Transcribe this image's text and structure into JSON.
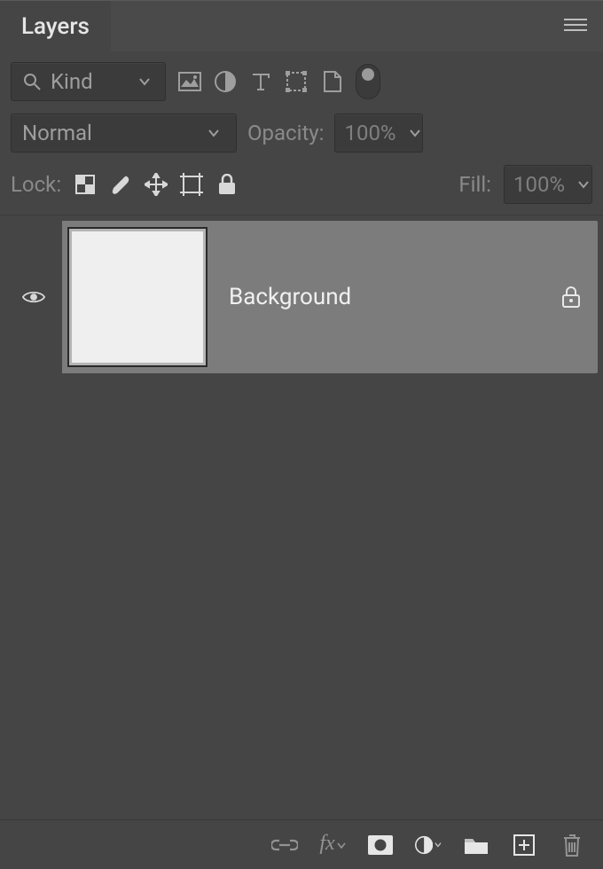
{
  "header": {
    "tab_label": "Layers"
  },
  "filter": {
    "kind_label": "Kind"
  },
  "blend": {
    "mode_label": "Normal",
    "opacity_label": "Opacity:",
    "opacity_value": "100%"
  },
  "lock": {
    "lock_label": "Lock:",
    "fill_label": "Fill:",
    "fill_value": "100%"
  },
  "layers": [
    {
      "name": "Background",
      "visible": true,
      "locked": true
    }
  ],
  "bottom_bar": {
    "link": "link",
    "fx": "fx",
    "mask": "mask",
    "adjustment": "adjustment",
    "group": "group",
    "new": "new",
    "delete": "delete"
  }
}
